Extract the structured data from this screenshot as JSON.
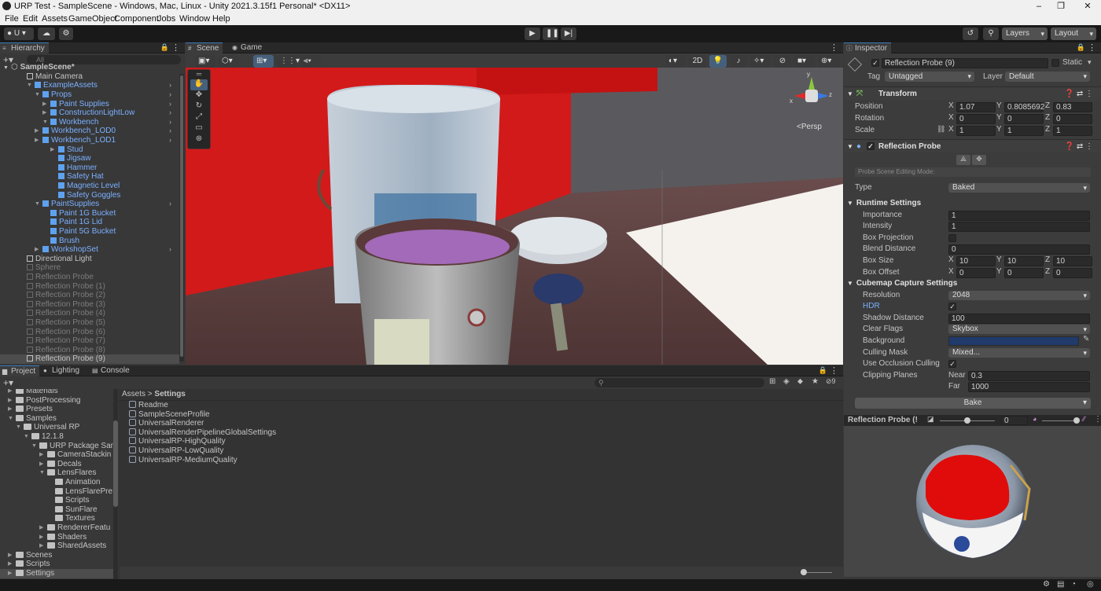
{
  "title_bar": {
    "title": "URP Test - SampleScene - Windows, Mac, Linux - Unity 2021.3.15f1 Personal* <DX11>",
    "minimize": "–",
    "maximize": "❐",
    "close": "✕"
  },
  "menu": [
    "File",
    "Edit",
    "Assets",
    "GameObject",
    "Component",
    "Jobs",
    "Window",
    "Help"
  ],
  "toolbar": {
    "account": "U",
    "layers": "Layers",
    "layout": "Layout"
  },
  "hierarchy": {
    "tab": "Hierarchy",
    "search_placeholder": "All",
    "scene": "SampleScene*",
    "items": [
      {
        "label": "Main Camera",
        "style": "normal"
      },
      {
        "label": "ExampleAssets",
        "style": "blue"
      },
      {
        "label": "Props",
        "style": "blue"
      },
      {
        "label": "Paint Supplies",
        "style": "blue"
      },
      {
        "label": "ConstructionLightLow",
        "style": "blue"
      },
      {
        "label": "Workbench",
        "style": "blue"
      },
      {
        "label": "Workbench_LOD0",
        "style": "blue"
      },
      {
        "label": "Workbench_LOD1",
        "style": "blue"
      },
      {
        "label": "Stud",
        "style": "blue"
      },
      {
        "label": "Jigsaw",
        "style": "blue"
      },
      {
        "label": "Hammer",
        "style": "blue"
      },
      {
        "label": "Safety Hat",
        "style": "blue"
      },
      {
        "label": "Magnetic Level",
        "style": "blue"
      },
      {
        "label": "Safety Goggles",
        "style": "blue"
      },
      {
        "label": "PaintSupplies",
        "style": "blue"
      },
      {
        "label": "Paint 1G Bucket",
        "style": "blue"
      },
      {
        "label": "Paint 1G Lid",
        "style": "blue"
      },
      {
        "label": "Paint 5G Bucket",
        "style": "blue"
      },
      {
        "label": "Brush",
        "style": "blue"
      },
      {
        "label": "WorkshopSet",
        "style": "blue"
      },
      {
        "label": "Directional Light",
        "style": "normal"
      },
      {
        "label": "Sphere",
        "style": "grey"
      },
      {
        "label": "Reflection Probe",
        "style": "grey"
      },
      {
        "label": "Reflection Probe (1)",
        "style": "grey"
      },
      {
        "label": "Reflection Probe (2)",
        "style": "grey"
      },
      {
        "label": "Reflection Probe (3)",
        "style": "grey"
      },
      {
        "label": "Reflection Probe (4)",
        "style": "grey"
      },
      {
        "label": "Reflection Probe (5)",
        "style": "grey"
      },
      {
        "label": "Reflection Probe (6)",
        "style": "grey"
      },
      {
        "label": "Reflection Probe (7)",
        "style": "grey"
      },
      {
        "label": "Reflection Probe (8)",
        "style": "grey"
      },
      {
        "label": "Reflection Probe (9)",
        "style": "selected"
      }
    ]
  },
  "scene_view": {
    "tab_scene": "Scene",
    "tab_game": "Game",
    "mode_2d": "2D",
    "persp": "Persp",
    "gizmo_x": "x",
    "gizmo_y": "y",
    "gizmo_z": "z"
  },
  "inspector": {
    "tab": "Inspector",
    "object_name": "Reflection Probe (9)",
    "static_label": "Static",
    "tag_label": "Tag",
    "tag_value": "Untagged",
    "layer_label": "Layer",
    "layer_value": "Default",
    "transform": {
      "title": "Transform",
      "position_label": "Position",
      "position": [
        "1.07",
        "0.8085692",
        "0.83"
      ],
      "rotation_label": "Rotation",
      "rotation": [
        "0",
        "0",
        "0"
      ],
      "scale_label": "Scale",
      "scale": [
        "1",
        "1",
        "1"
      ]
    },
    "probe": {
      "title": "Reflection Probe",
      "editing_mode": "Probe Scene Editing Mode:",
      "type_label": "Type",
      "type_value": "Baked",
      "runtime_title": "Runtime Settings",
      "importance_label": "Importance",
      "importance": "1",
      "intensity_label": "Intensity",
      "intensity": "1",
      "box_projection_label": "Box Projection",
      "blend_distance_label": "Blend Distance",
      "blend_distance": "0",
      "box_size_label": "Box Size",
      "box_size": [
        "10",
        "10",
        "10"
      ],
      "box_offset_label": "Box Offset",
      "box_offset": [
        "0",
        "0",
        "0"
      ],
      "cubemap_title": "Cubemap Capture Settings",
      "resolution_label": "Resolution",
      "resolution": "2048",
      "hdr_label": "HDR",
      "shadow_distance_label": "Shadow Distance",
      "shadow_distance": "100",
      "clear_flags_label": "Clear Flags",
      "clear_flags": "Skybox",
      "background_label": "Background",
      "background_color": "#1f3a6b",
      "culling_mask_label": "Culling Mask",
      "culling_mask": "Mixed...",
      "occlusion_label": "Use Occlusion Culling",
      "clipping_label": "Clipping Planes",
      "near_label": "Near",
      "near": "0.3",
      "far_label": "Far",
      "far": "1000",
      "bake_button": "Bake"
    },
    "preview": {
      "title": "Reflection Probe (!",
      "exposure": "0"
    },
    "axis": {
      "x": "X",
      "y": "Y",
      "z": "Z"
    }
  },
  "project": {
    "tab_project": "Project",
    "tab_lighting": "Lighting",
    "tab_console": "Console",
    "hidden_count": "9",
    "breadcrumb": [
      "Assets",
      "Settings"
    ],
    "tree": [
      {
        "label": "Materials",
        "indent": 1
      },
      {
        "label": "PostProcessing",
        "indent": 1
      },
      {
        "label": "Presets",
        "indent": 1
      },
      {
        "label": "Samples",
        "indent": 1
      },
      {
        "label": "Universal RP",
        "indent": 2
      },
      {
        "label": "12.1.8",
        "indent": 3
      },
      {
        "label": "URP Package San",
        "indent": 4
      },
      {
        "label": "CameraStackin",
        "indent": 5
      },
      {
        "label": "Decals",
        "indent": 5
      },
      {
        "label": "LensFlares",
        "indent": 5
      },
      {
        "label": "Animation",
        "indent": 6
      },
      {
        "label": "LensFlarePre",
        "indent": 6
      },
      {
        "label": "Scripts",
        "indent": 6
      },
      {
        "label": "SunFlare",
        "indent": 6
      },
      {
        "label": "Textures",
        "indent": 6
      },
      {
        "label": "RendererFeatu",
        "indent": 5
      },
      {
        "label": "Shaders",
        "indent": 5
      },
      {
        "label": "SharedAssets",
        "indent": 5
      },
      {
        "label": "Scenes",
        "indent": 1
      },
      {
        "label": "Scripts",
        "indent": 1
      },
      {
        "label": "Settings",
        "indent": 1
      }
    ],
    "assets": [
      "Readme",
      "SampleSceneProfile",
      "UniversalRenderer",
      "UniversalRenderPipelineGlobalSettings",
      "UniversalRP-HighQuality",
      "UniversalRP-LowQuality",
      "UniversalRP-MediumQuality"
    ]
  },
  "colors": {
    "accent": "#3a79bb",
    "selected_row": "#4d4d4d",
    "red_wall": "#d21a1a"
  }
}
